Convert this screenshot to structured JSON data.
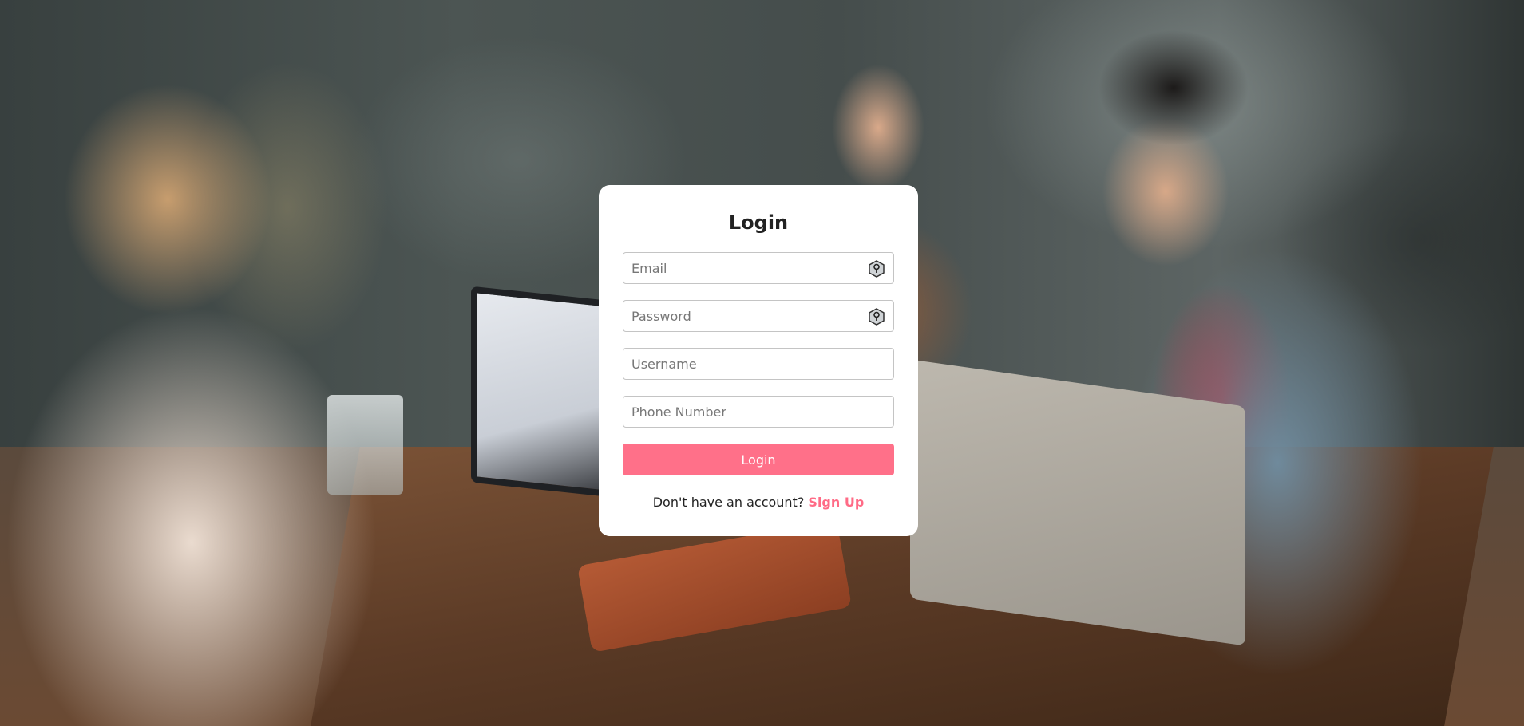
{
  "login_card": {
    "title": "Login",
    "fields": [
      {
        "placeholder": "Email",
        "icon": "key-icon"
      },
      {
        "placeholder": "Password",
        "icon": "key-icon"
      },
      {
        "placeholder": "Username"
      },
      {
        "placeholder": "Phone Number"
      }
    ],
    "submit_label": "Login",
    "signup_prompt": "Don't have an account?",
    "signup_link": "Sign Up"
  },
  "colors": {
    "accent": "#ff7089",
    "link": "#ff6b86",
    "card_bg": "#ffffff",
    "title_text": "#222222"
  }
}
